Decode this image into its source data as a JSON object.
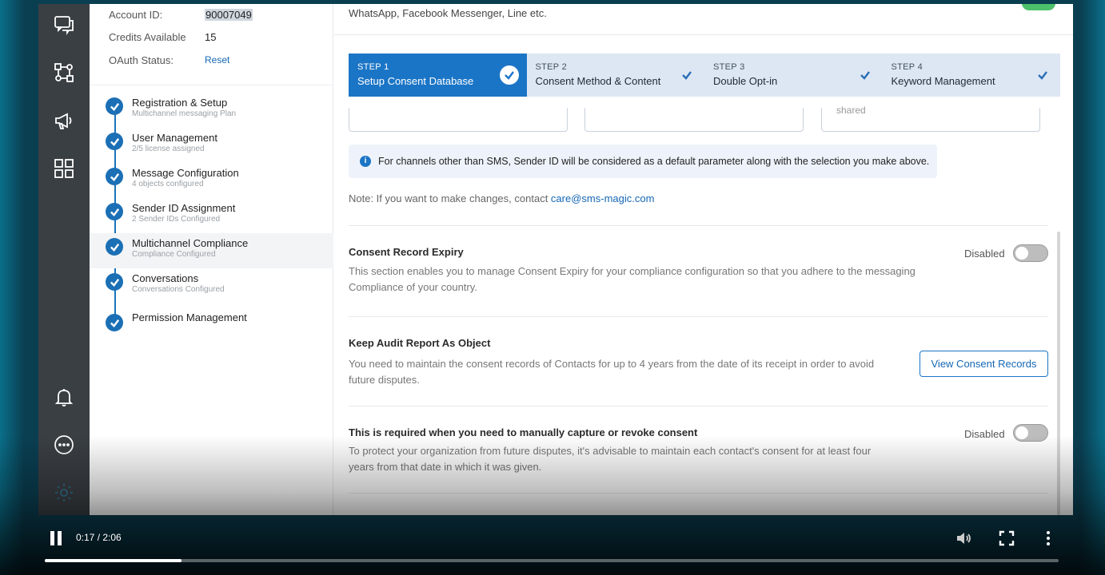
{
  "account": {
    "id_label": "Account ID:",
    "id_value": "90007049",
    "credits_label": "Credits Available",
    "credits_value": "15",
    "oauth_label": "OAuth Status:",
    "oauth_action": "Reset"
  },
  "setup_steps": [
    {
      "title": "Registration & Setup",
      "subtitle": "Multichannel messaging Plan"
    },
    {
      "title": "User Management",
      "subtitle": "2/5 license assigned"
    },
    {
      "title": "Message Configuration",
      "subtitle": "4 objects configured"
    },
    {
      "title": "Sender ID Assignment",
      "subtitle": "2 Sender IDs Configured"
    },
    {
      "title": "Multichannel Compliance",
      "subtitle": "Compliance Configured"
    },
    {
      "title": "Conversations",
      "subtitle": "Conversations Configured"
    },
    {
      "title": "Permission Management",
      "subtitle": ""
    }
  ],
  "rail_icons": [
    "chat-icon",
    "flow-icon",
    "megaphone-icon",
    "grid-icon",
    "bell-icon",
    "more-icon",
    "settings-icon"
  ],
  "main": {
    "top_text": "WhatsApp, Facebook Messenger, Line etc.",
    "wizard": [
      {
        "label": "STEP 1",
        "title": "Setup Consent Database"
      },
      {
        "label": "STEP 2",
        "title": "Consent Method & Content"
      },
      {
        "label": "STEP 3",
        "title": "Double Opt-in"
      },
      {
        "label": "STEP 4",
        "title": "Keyword Management"
      }
    ],
    "option_text": "shared",
    "info": "For channels other than SMS, Sender ID will be considered as a default parameter along with the selection you make above.",
    "note_prefix": "Note: If you want to make changes, contact ",
    "note_email": "care@sms-magic.com",
    "expiry": {
      "title": "Consent Record Expiry",
      "desc": "This section enables you to manage Consent Expiry for your compliance configuration so that you adhere to the messaging Compliance of your country.",
      "toggle_label": "Disabled"
    },
    "audit": {
      "title": "Keep Audit Report As Object",
      "desc": "You need to maintain the consent records of Contacts for up to 4 years from the date of its receipt in order to avoid future disputes.",
      "button": "View Consent Records"
    },
    "manual": {
      "title": "This is required when you need to manually capture or revoke consent",
      "desc": "To protect your organization from future disputes, it's advisable to maintain each contact's consent for at least four years from that date in which it was given.",
      "toggle_label": "Disabled"
    }
  },
  "video": {
    "time": "0:17 / 2:06",
    "progress": 0.1349
  },
  "colors": {
    "accent": "#1b75c6",
    "rail": "#3a3f44",
    "step_inactive": "#dde7f4"
  }
}
